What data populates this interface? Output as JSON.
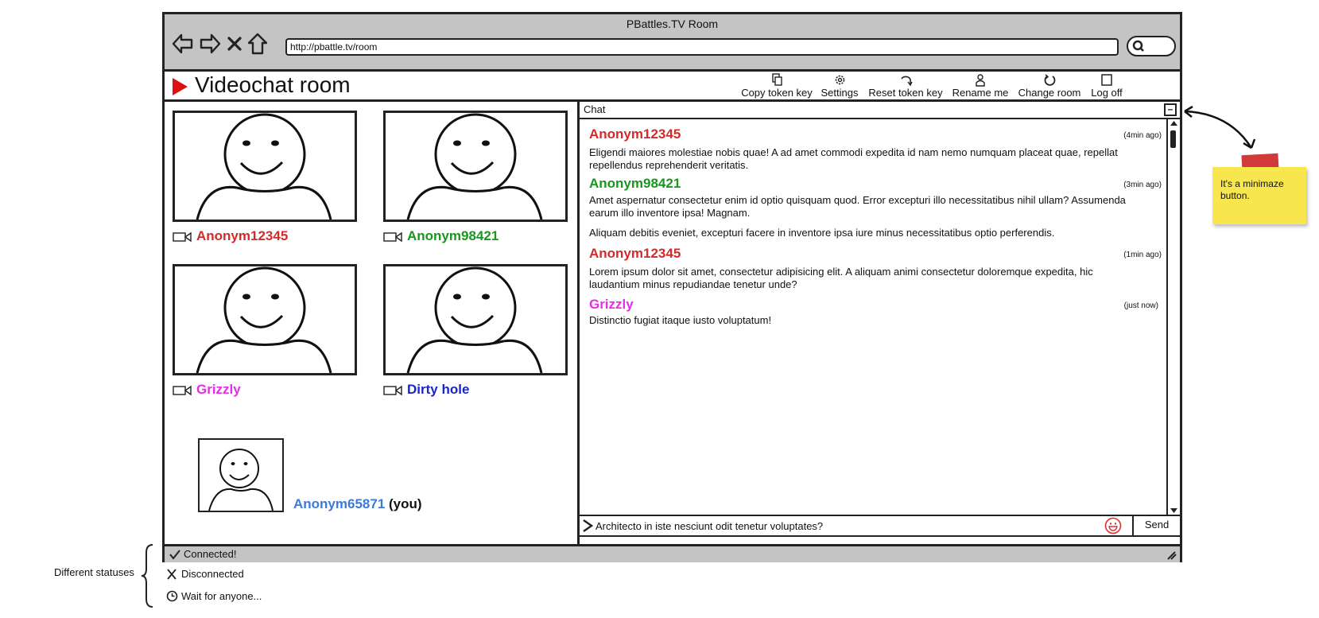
{
  "browser": {
    "window_title": "PBattles.TV Room",
    "url": "http://pbattle.tv/room"
  },
  "app": {
    "title": "Videochat room",
    "toolbar": [
      {
        "label": "Copy token key",
        "icon": "copy-icon"
      },
      {
        "label": "Settings",
        "icon": "gear-icon"
      },
      {
        "label": "Reset token key",
        "icon": "redo-icon"
      },
      {
        "label": "Rename me",
        "icon": "user-icon"
      },
      {
        "label": "Change room",
        "icon": "refresh-icon"
      },
      {
        "label": "Log off",
        "icon": "checkbox-icon"
      }
    ]
  },
  "participants": [
    {
      "name": "Anonym12345",
      "color": "#d42a2a"
    },
    {
      "name": "Anonym98421",
      "color": "#18961e"
    },
    {
      "name": "Grizzly",
      "color": "#e62ce6"
    },
    {
      "name": "Dirty hole",
      "color": "#1b24c8"
    }
  ],
  "self": {
    "name": "Anonym65871",
    "suffix": "(you)",
    "color": "#3a7ad8"
  },
  "chat": {
    "title": "Chat",
    "minimize_label": "–",
    "messages": [
      {
        "author": "Anonym12345",
        "color": "#d42a2a",
        "time": "(4min ago)",
        "texts": [
          "Eligendi maiores molestiae nobis quae! A ad amet commodi expedita id nam nemo numquam placeat quae, repellat repellendus reprehenderit veritatis."
        ]
      },
      {
        "author": "Anonym98421",
        "color": "#18961e",
        "time": "(3min ago)",
        "texts": [
          "Amet aspernatur consectetur enim id optio quisquam quod. Error excepturi illo necessitatibus nihil ullam? Assumenda earum illo inventore ipsa! Magnam.",
          "Aliquam debitis eveniet, excepturi facere in inventore ipsa iure minus necessitatibus optio perferendis."
        ]
      },
      {
        "author": "Anonym12345",
        "color": "#d42a2a",
        "time": "(1min ago)",
        "texts": [
          "Lorem ipsum dolor sit amet, consectetur adipisicing elit. A aliquam animi consectetur doloremque expedita, hic laudantium minus repudiandae tenetur unde?"
        ]
      },
      {
        "author": "Grizzly",
        "color": "#e62ce6",
        "time": "(just now)",
        "texts": [
          "Distinctio fugiat itaque iusto voluptatum!"
        ]
      }
    ],
    "input_value": "Architecto in iste nesciunt odit tenetur voluptates?",
    "send_label": "Send"
  },
  "status": {
    "current": "Connected!"
  },
  "annotations": {
    "statuses_label": "Different statuses",
    "statuses": [
      "Connected!",
      "Disconnected",
      "Wait for anyone..."
    ],
    "sticky_note": "It's a minimaze button."
  }
}
